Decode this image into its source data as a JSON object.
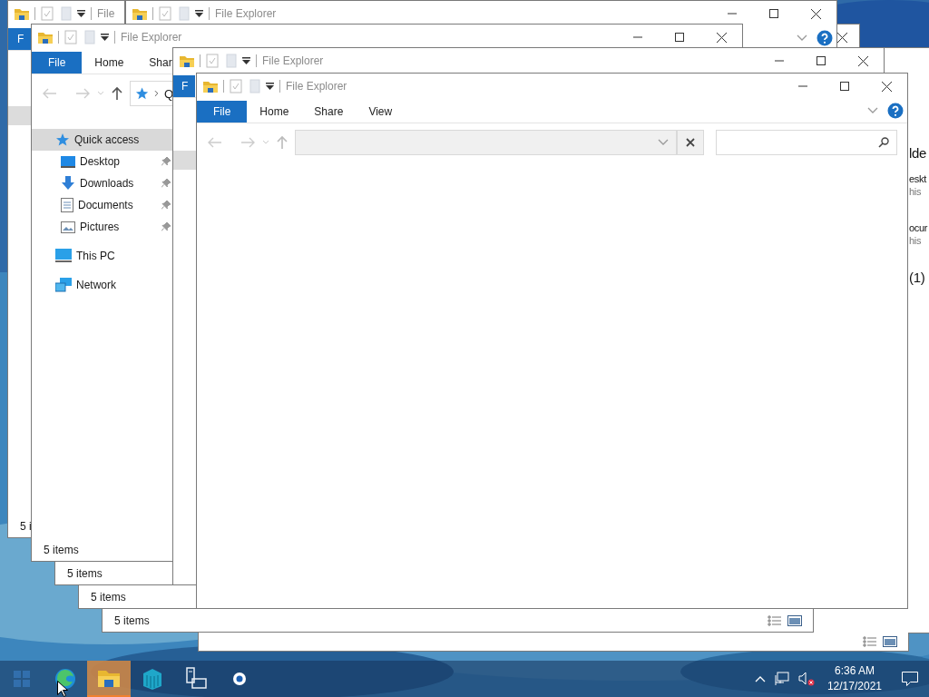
{
  "window_a": {
    "title": "File",
    "tab": "F",
    "status": "5 i"
  },
  "window_b": {
    "title": "File Explorer"
  },
  "window_behind": {
    "content": [
      {
        "kind": "heading",
        "text": "lde"
      },
      {
        "kind": "name",
        "text": "eskt"
      },
      {
        "kind": "sub",
        "text": "his"
      },
      {
        "kind": "name",
        "text": "ocur"
      },
      {
        "kind": "sub",
        "text": "his"
      },
      {
        "kind": "heading",
        "text": "(1)"
      }
    ]
  },
  "status_strips": [
    {
      "status": "5 items"
    },
    {
      "status": "5 items"
    },
    {
      "status": "5 items"
    }
  ],
  "window_c": {
    "title": "File Explorer",
    "tabs": [
      {
        "label": "File",
        "selected": true
      },
      {
        "label": "Home",
        "selected": false
      },
      {
        "label": "Shar",
        "selected": false
      }
    ],
    "address": "Q",
    "nav": [
      {
        "kind": "quick",
        "label": "Quick access",
        "selected": true,
        "children": [
          {
            "kind": "desktop",
            "label": "Desktop",
            "pinned": true
          },
          {
            "kind": "downloads",
            "label": "Downloads",
            "pinned": true
          },
          {
            "kind": "documents",
            "label": "Documents",
            "pinned": true
          },
          {
            "kind": "pictures",
            "label": "Pictures",
            "pinned": true
          }
        ]
      },
      {
        "kind": "pc",
        "label": "This PC",
        "selected": false
      },
      {
        "kind": "network",
        "label": "Network",
        "selected": false
      }
    ],
    "status": "5 items"
  },
  "window_e": {
    "title": "File Explorer",
    "tab": "F"
  },
  "window_g": {
    "title": "File Explorer",
    "tabs": [
      {
        "label": "File",
        "selected": true
      },
      {
        "label": "Home",
        "selected": false
      },
      {
        "label": "Share",
        "selected": false
      },
      {
        "label": "View",
        "selected": false
      }
    ]
  },
  "taskbar": {
    "apps": [
      {
        "kind": "start",
        "active": false
      },
      {
        "kind": "edge",
        "active": false
      },
      {
        "kind": "explorer",
        "active": true
      },
      {
        "kind": "stack",
        "active": false
      },
      {
        "kind": "server",
        "active": false
      },
      {
        "kind": "circle",
        "active": false
      }
    ],
    "time": "6:36 AM",
    "date": "12/17/2021"
  }
}
